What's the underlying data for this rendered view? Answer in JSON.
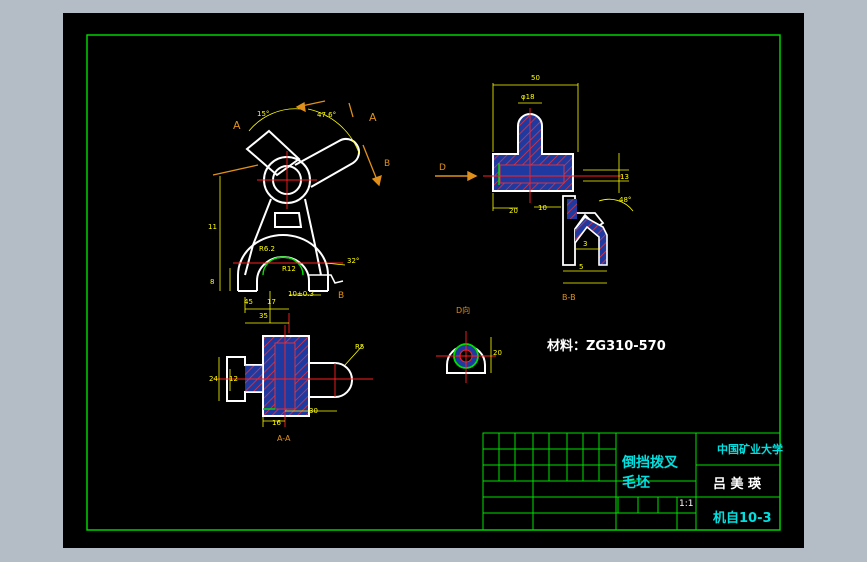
{
  "colors": {
    "background": "#b4bcc6",
    "paper": "#000000",
    "border": "#00e000",
    "outline": "#ffffff",
    "dimension": "#ffff00",
    "centerline": "#ff2020",
    "hatch": "#ff3030",
    "fill": "#1e3aa0",
    "annotation": "#e0901a",
    "title_text": "#00e0e0"
  },
  "views": {
    "section_a": "A",
    "section_a2": "A",
    "arrow_b": "B",
    "arrow_b2": "B",
    "arrow_d": "D",
    "section_aa_label": "A-A",
    "section_bb_label": "B-B",
    "view_d_label": "D向"
  },
  "dimensions": {
    "angle_15": "15°",
    "angle_47": "47.6°",
    "angle_48": "48°",
    "angle_32": "32°",
    "dim_r62": "R6.2",
    "dim_r12": "R12",
    "dim_11": "11",
    "dim_8": "8",
    "dim_17": "17",
    "dim_45": "45",
    "dim_10pm": "10±0.3",
    "dim_35": "35",
    "dim_50": "50",
    "dim_phi18": "φ18",
    "dim_20": "20",
    "dim_10": "10",
    "dim_5": "5",
    "dim_3": "3",
    "dim_24": "24",
    "dim_16": "16",
    "dim_30": "30",
    "dim_dia": "R5",
    "dim_d20": "20",
    "dim_12": "12",
    "dim_13": "13"
  },
  "material_note": "材料：ZG310-570",
  "title_block": {
    "part_name_line1": "倒挡拨叉",
    "part_name_line2": "毛坯",
    "school": "中国矿业大学",
    "designer": "吕 美 瑛",
    "class_code": "机自10-3",
    "scale": "1:1"
  }
}
